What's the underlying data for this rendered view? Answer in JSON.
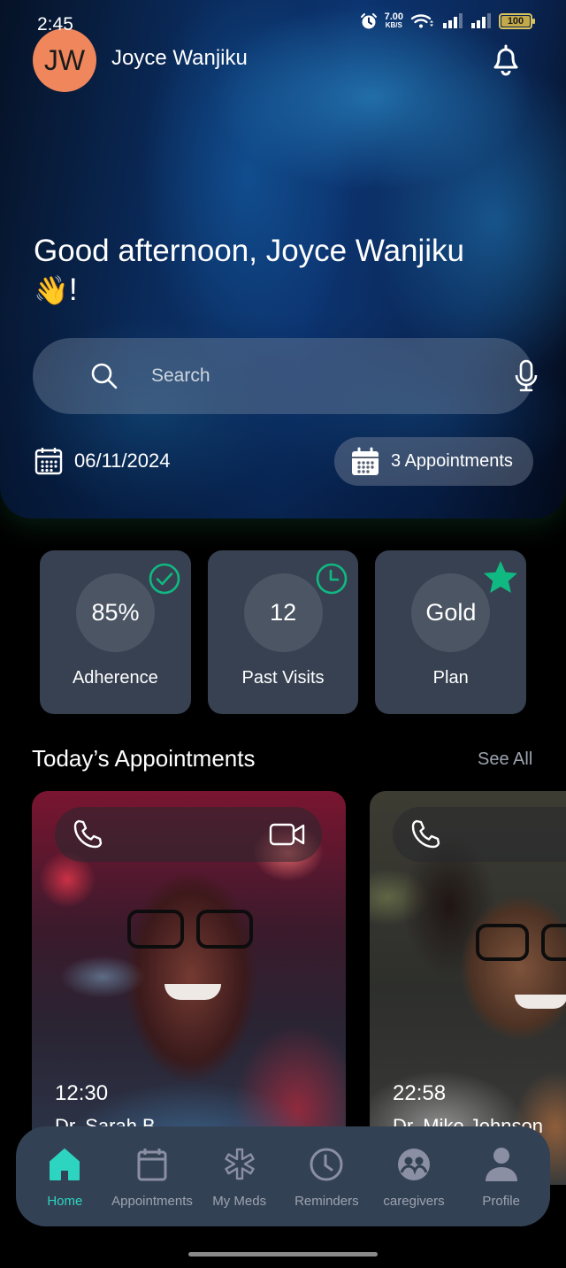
{
  "status_bar": {
    "time": "2:45",
    "net_speed_value": "7.00",
    "net_speed_unit": "KB/S",
    "battery_level": "100",
    "battery_percent": 100,
    "icons": [
      "alarm-icon",
      "wifi-icon",
      "signal-icon",
      "signal-icon",
      "battery-icon"
    ]
  },
  "header": {
    "avatar_initials": "JW",
    "user_name": "Joyce Wanjiku",
    "notification_icon": "bell-icon",
    "greeting": "Good afternoon, Joyce Wanjiku",
    "greeting_emoji": "👋",
    "greeting_suffix": "!"
  },
  "search": {
    "placeholder": "Search",
    "value": "",
    "icon": "search-icon",
    "voice_icon": "mic-icon"
  },
  "date_info": {
    "date": "06/11/2024",
    "appointments_count_label": "3 Appointments"
  },
  "stats": [
    {
      "value": "85%",
      "label": "Adherence",
      "badge_icon": "check-circle-icon"
    },
    {
      "value": "12",
      "label": "Past Visits",
      "badge_icon": "clock-icon"
    },
    {
      "value": "Gold",
      "label": "Plan",
      "badge_icon": "star-icon"
    }
  ],
  "colors": {
    "accent": "#2dd4bf",
    "badge_green": "#10b981",
    "avatar_bg": "#f0875c",
    "card_bg": "#374151",
    "nav_bg": "#334155"
  },
  "appointments_section": {
    "title": "Today’s Appointments",
    "see_all_label": "See All",
    "items": [
      {
        "time": "12:30",
        "doctor": "Dr. Sarah B",
        "actions": [
          "phone-icon",
          "video-icon"
        ]
      },
      {
        "time": "22:58",
        "doctor": "Dr. Mike Johnson",
        "actions": [
          "phone-icon"
        ]
      }
    ]
  },
  "bottom_nav": {
    "items": [
      {
        "label": "Home",
        "icon": "home-icon",
        "active": true
      },
      {
        "label": "Appointments",
        "icon": "calendar-icon",
        "active": false
      },
      {
        "label": "My Meds",
        "icon": "medical-asterisk-icon",
        "active": false
      },
      {
        "label": "Reminders",
        "icon": "clock-icon",
        "active": false
      },
      {
        "label": "caregivers",
        "icon": "caregivers-icon",
        "active": false
      },
      {
        "label": "Profile",
        "icon": "user-icon",
        "active": false
      }
    ]
  }
}
